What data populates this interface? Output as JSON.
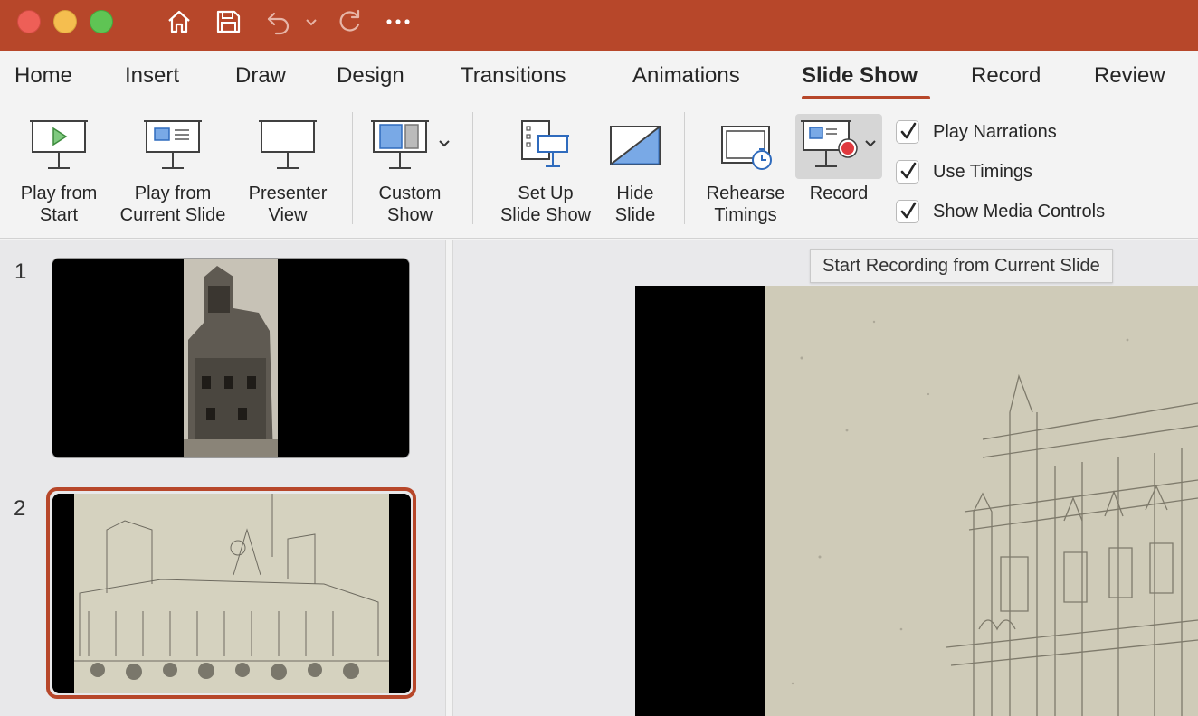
{
  "window": {
    "traffic_lights": [
      "close",
      "minimize",
      "zoom"
    ],
    "quick_access": [
      "home-icon",
      "save-icon",
      "undo-icon",
      "undo-dropdown-icon",
      "redo-icon",
      "more-icon"
    ],
    "colors": {
      "titlebar": "#b7472a",
      "accent": "#b7472a"
    }
  },
  "tabs": [
    {
      "label": "Home"
    },
    {
      "label": "Insert"
    },
    {
      "label": "Draw"
    },
    {
      "label": "Design"
    },
    {
      "label": "Transitions"
    },
    {
      "label": "Animations"
    },
    {
      "label": "Slide Show",
      "active": true
    },
    {
      "label": "Record"
    },
    {
      "label": "Review"
    }
  ],
  "ribbon": {
    "play_from_start": "Play from\nStart",
    "play_from_current": "Play from\nCurrent Slide",
    "presenter_view": "Presenter\nView",
    "custom_show": "Custom\nShow",
    "set_up_slide_show": "Set Up\nSlide Show",
    "hide_slide": "Hide\nSlide",
    "rehearse_timings": "Rehearse\nTimings",
    "record": "Record",
    "checkboxes": [
      {
        "label": "Play Narrations",
        "checked": true
      },
      {
        "label": "Use Timings",
        "checked": true
      },
      {
        "label": "Show Media Controls",
        "checked": true
      }
    ]
  },
  "tooltip": "Start Recording from Current Slide",
  "slides": [
    {
      "number": "1",
      "selected": false
    },
    {
      "number": "2",
      "selected": true
    }
  ]
}
